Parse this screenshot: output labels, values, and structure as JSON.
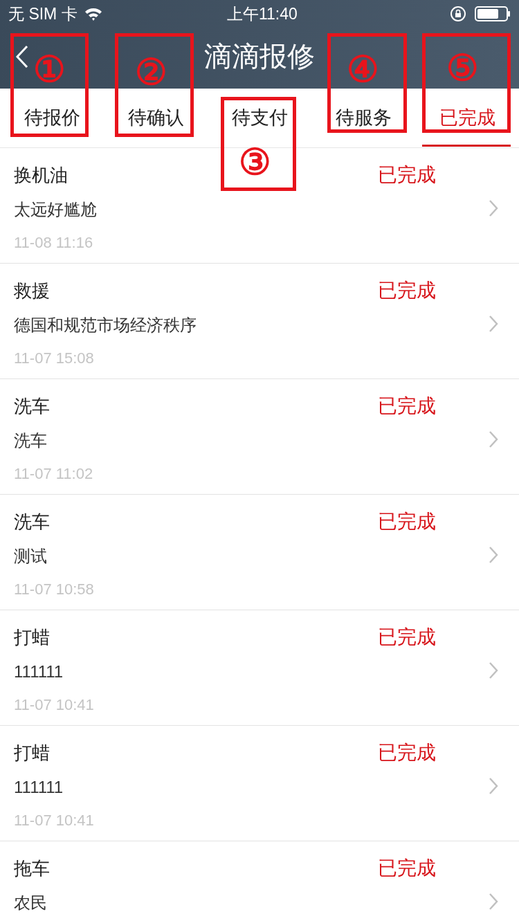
{
  "status_bar": {
    "carrier": "无 SIM 卡",
    "time": "上午11:40"
  },
  "nav": {
    "title": "滴滴报修"
  },
  "tabs": [
    {
      "label": "待报价",
      "selected": false
    },
    {
      "label": "待确认",
      "selected": false
    },
    {
      "label": "待支付",
      "selected": false
    },
    {
      "label": "待服务",
      "selected": false
    },
    {
      "label": "已完成",
      "selected": true
    }
  ],
  "orders": [
    {
      "title": "换机油",
      "status": "已完成",
      "description": "太远好尴尬",
      "time": "11-08 11:16"
    },
    {
      "title": "救援",
      "status": "已完成",
      "description": "德国和规范市场经济秩序",
      "time": "11-07 15:08"
    },
    {
      "title": "洗车",
      "status": "已完成",
      "description": "洗车",
      "time": "11-07 11:02"
    },
    {
      "title": "洗车",
      "status": "已完成",
      "description": "测试",
      "time": "11-07 10:58"
    },
    {
      "title": "打蜡",
      "status": "已完成",
      "description": "111111",
      "time": "11-07 10:41"
    },
    {
      "title": "打蜡",
      "status": "已完成",
      "description": "111111",
      "time": "11-07 10:41"
    },
    {
      "title": "拖车",
      "status": "已完成",
      "description": "农民"
    }
  ],
  "annotations": [
    {
      "label": "①"
    },
    {
      "label": "②"
    },
    {
      "label": "③"
    },
    {
      "label": "④"
    },
    {
      "label": "⑤"
    }
  ]
}
